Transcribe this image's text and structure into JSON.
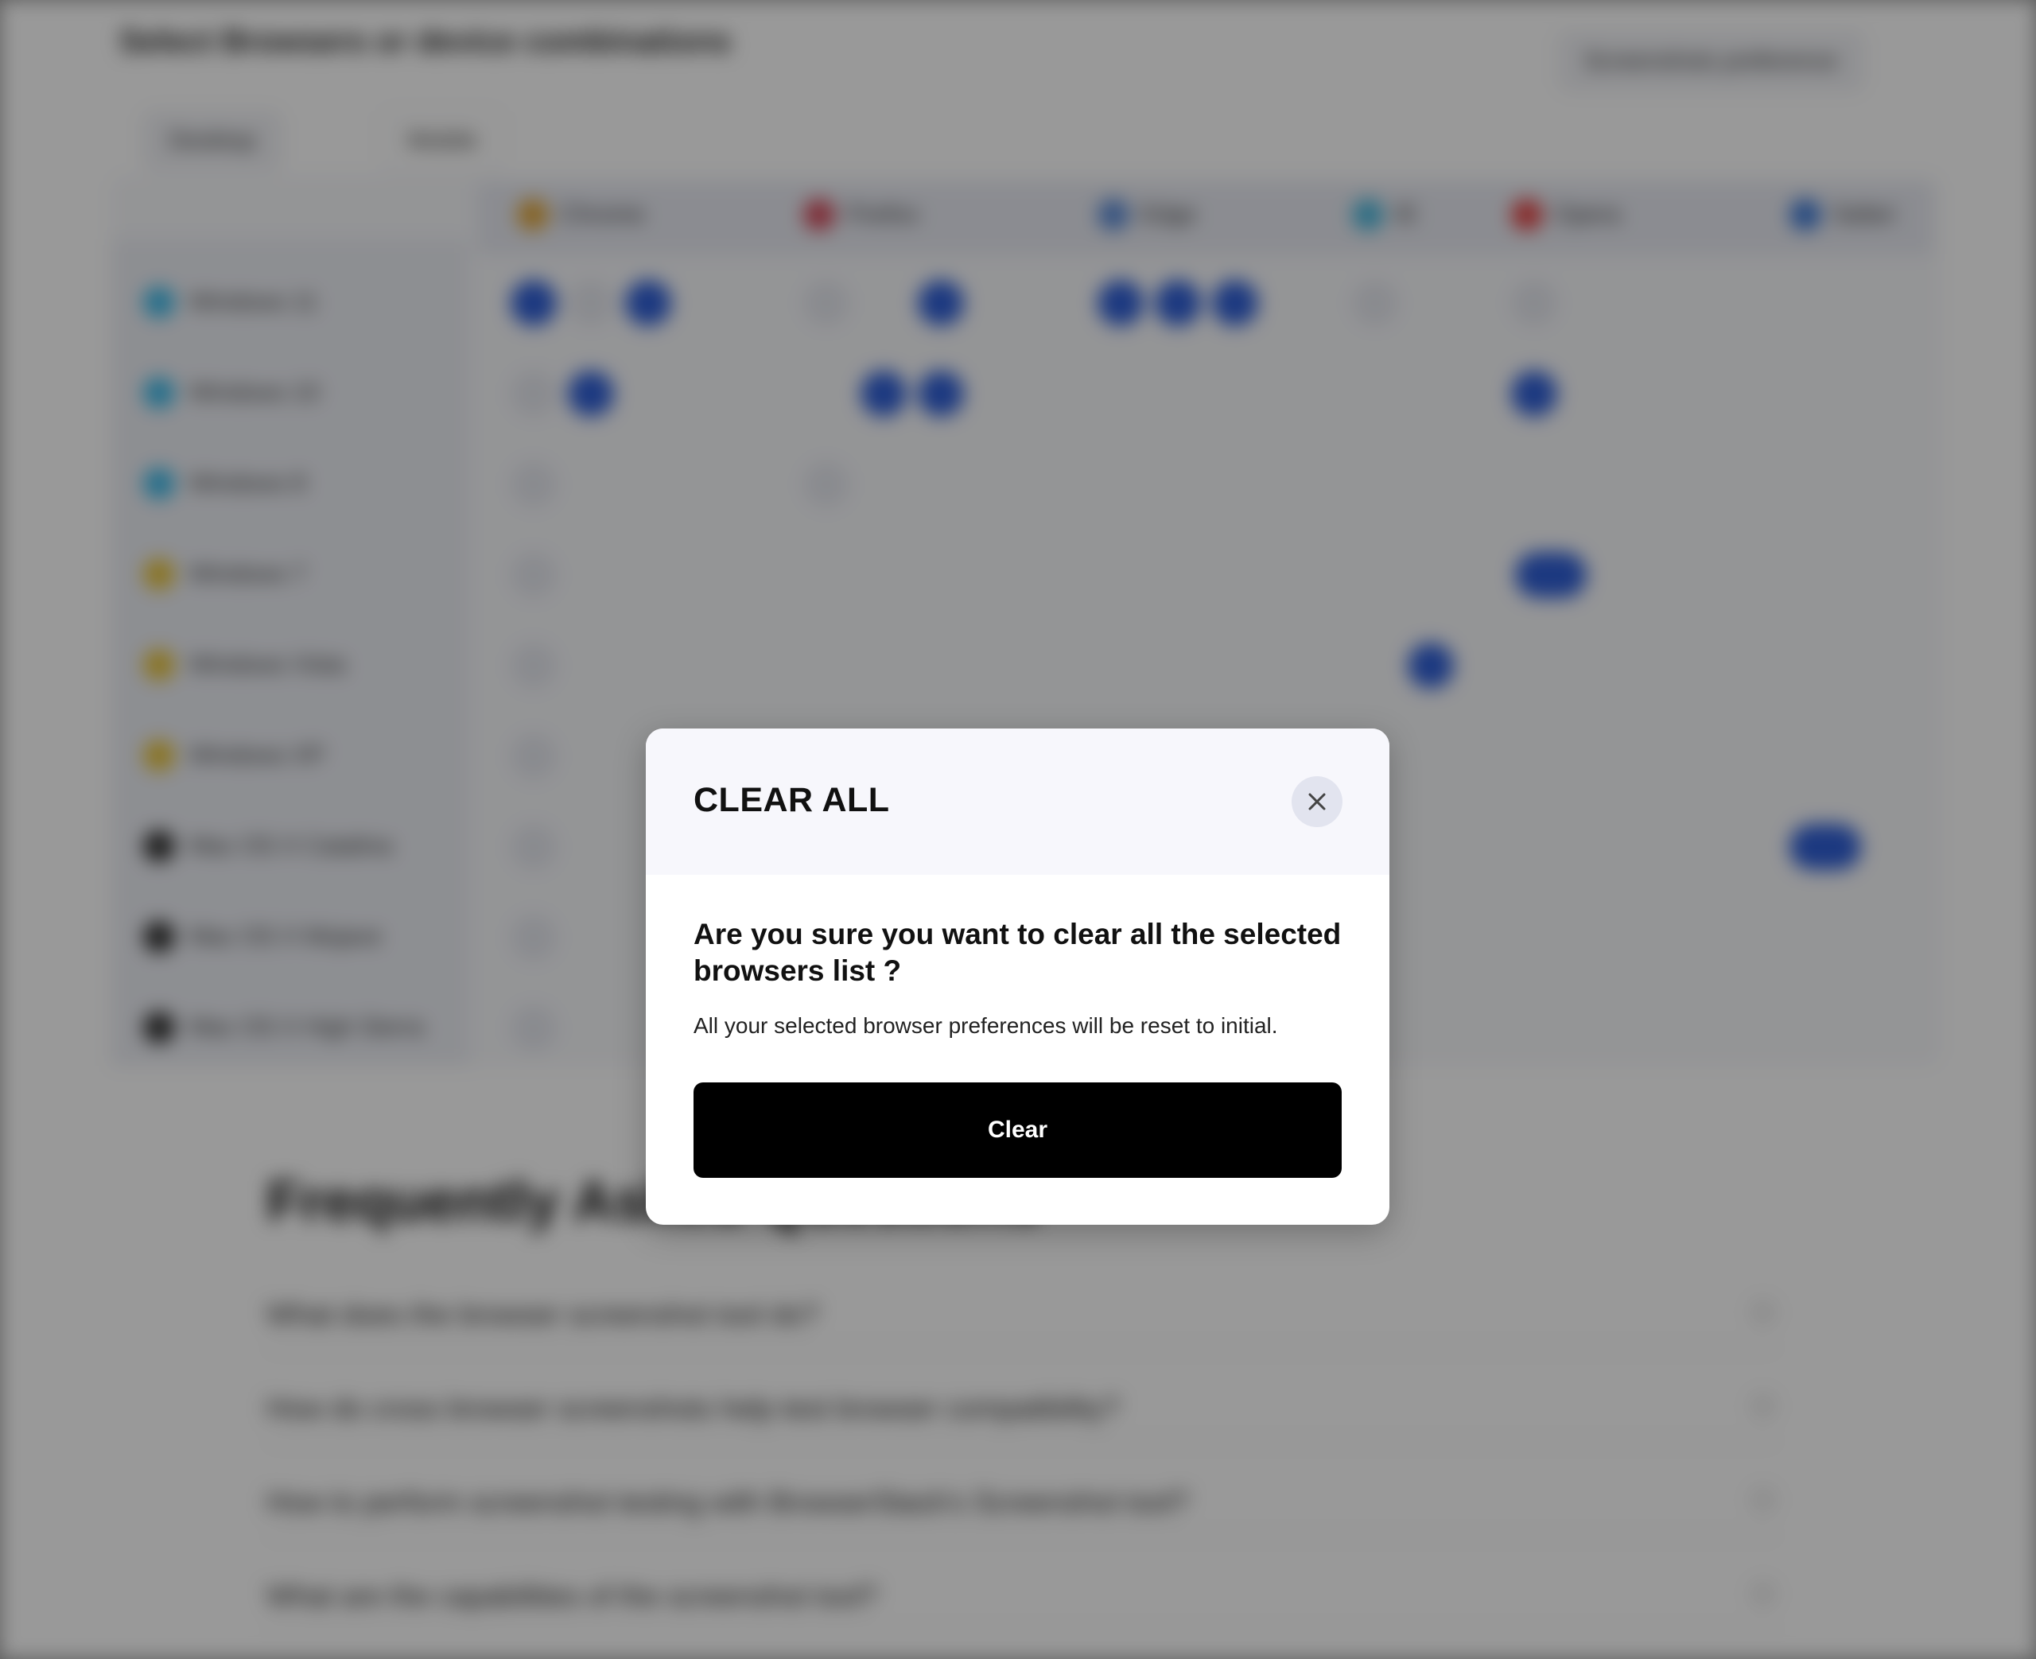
{
  "background": {
    "page_title": "Select Browsers or device combinations",
    "top_right_button": "Screenshots preference",
    "tabs": [
      "Desktop",
      "Mobile"
    ],
    "browsers": [
      "Chrome",
      "Firefox",
      "Edge",
      "IE",
      "Opera",
      "Safari"
    ],
    "os_rows": [
      "Windows 11",
      "Windows 10",
      "Windows 8",
      "Windows 7",
      "Windows Vista",
      "Windows XP",
      "Mac OS X Catalina",
      "Mac OS X Mojave",
      "Mac OS X High Sierra"
    ],
    "faq_title": "Frequently Asked Questions",
    "faq_questions": [
      "What does the browser screenshot tool do?",
      "How do cross browser screenshots help test browser compatibility?",
      "How to perform screenshot testing with BrowserStack's Screenshot tool?",
      "What are the capabilities of the screenshot tool?"
    ]
  },
  "modal": {
    "title": "CLEAR ALL",
    "question": "Are you sure you want to clear all the selected browsers list ?",
    "description": "All your selected browser preferences will be reset to initial.",
    "clear_label": "Clear",
    "close_icon": "close-icon"
  }
}
